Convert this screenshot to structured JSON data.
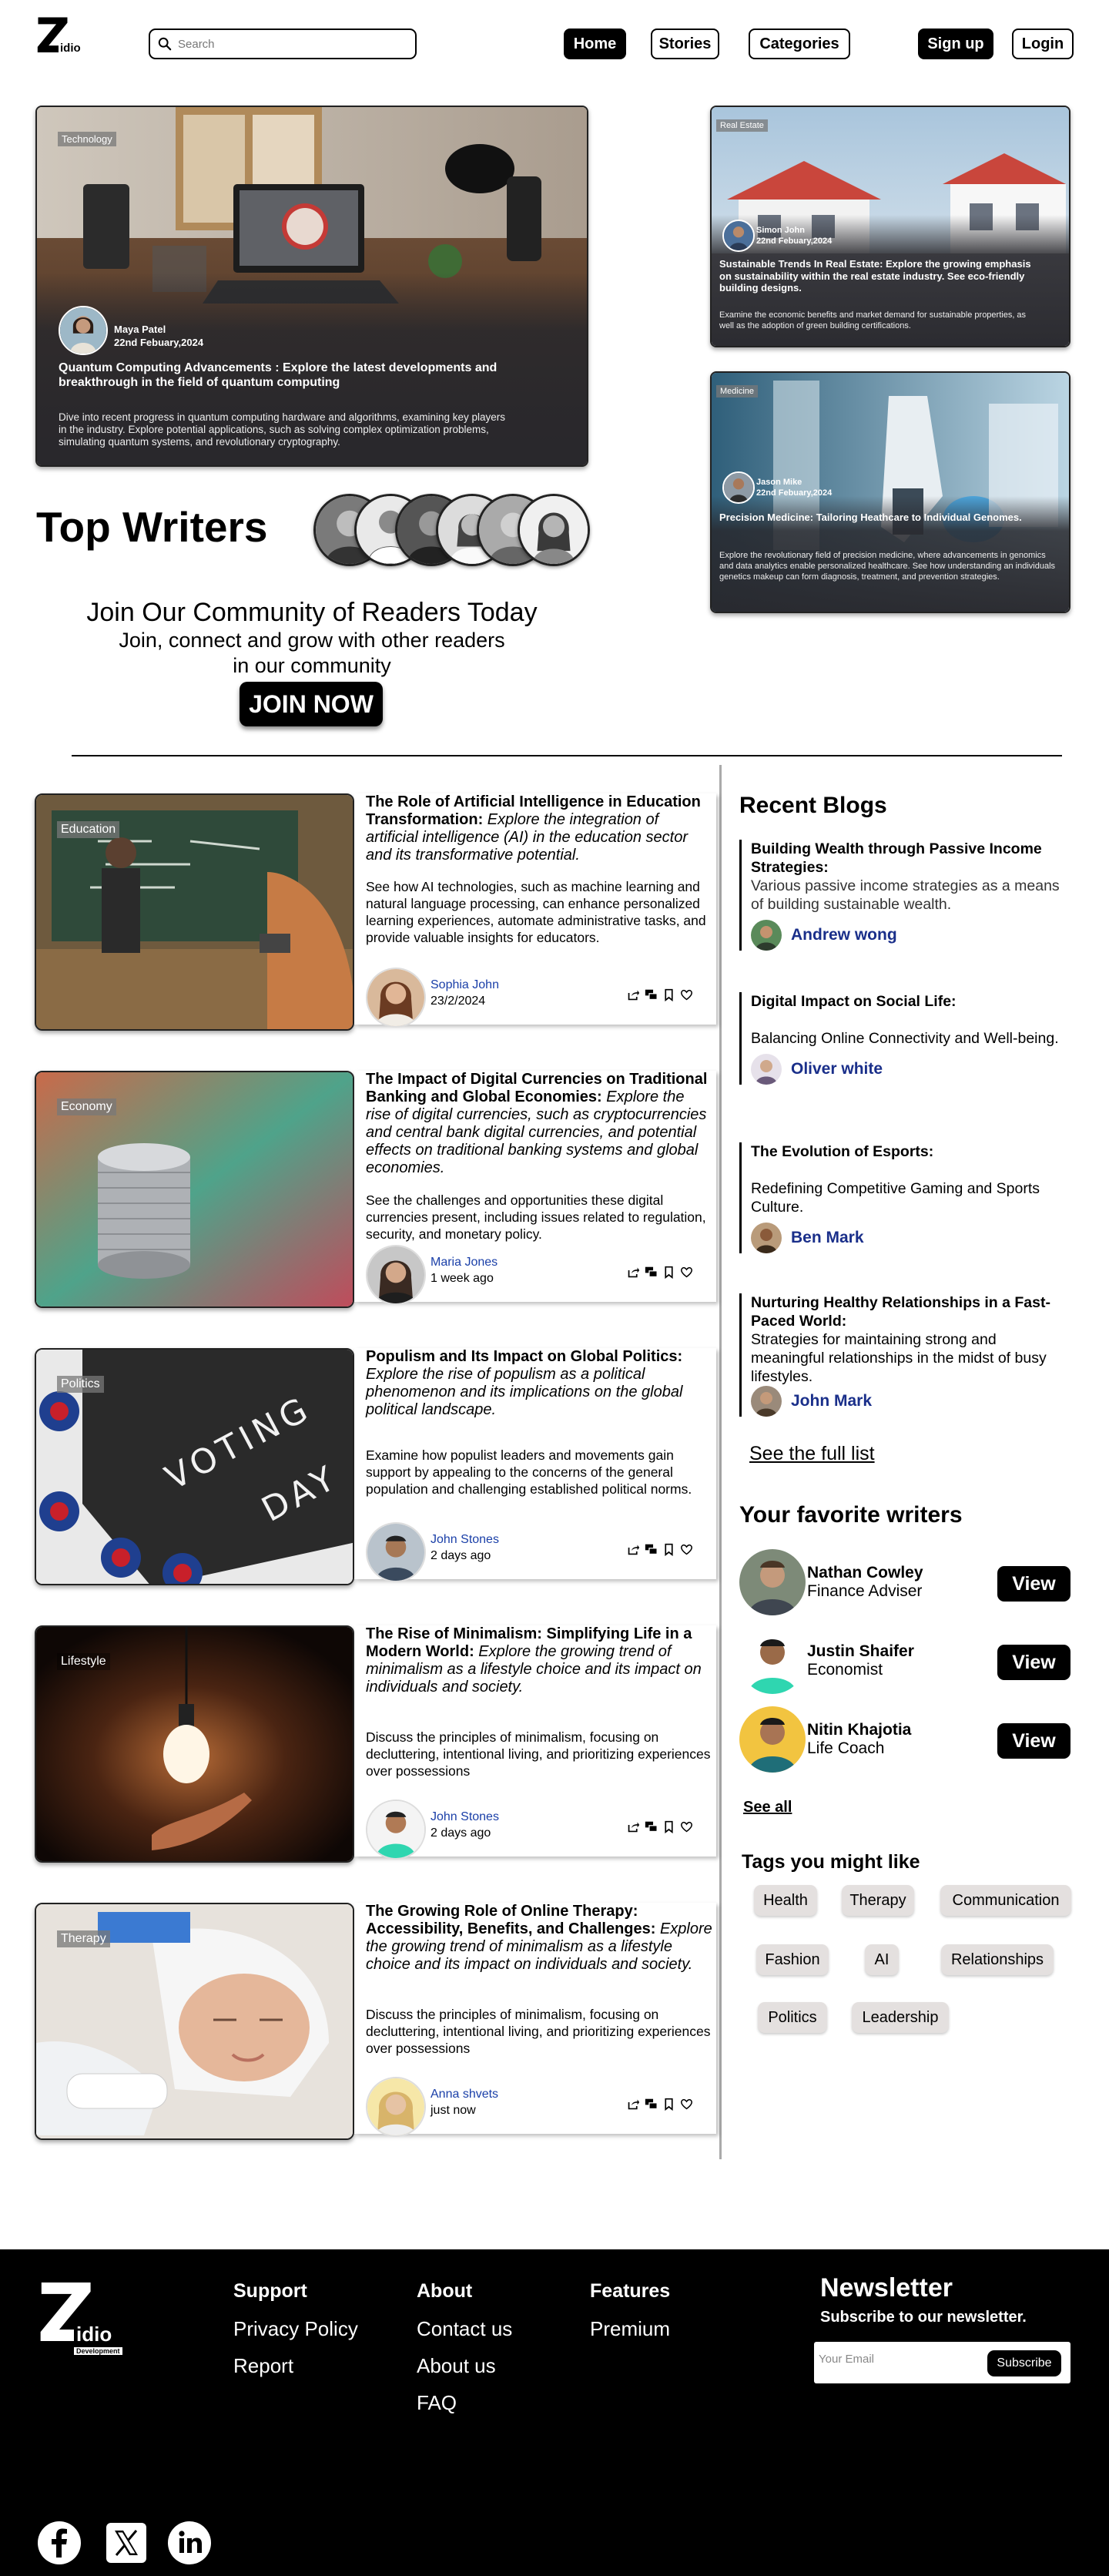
{
  "brand": {
    "logo_letter": "Z",
    "logo_text": "idio",
    "logo_sub": "Development"
  },
  "nav": {
    "search_placeholder": "Search",
    "home": "Home",
    "stories": "Stories",
    "categories": "Categories",
    "signup": "Sign up",
    "login": "Login"
  },
  "hero": {
    "main": {
      "tag": "Technology",
      "author": "Maya Patel",
      "date": "22nd Febuary,2024",
      "title": "Quantum Computing Advancements : Explore the latest developments and breakthrough in the field of quantum computing",
      "desc": "Dive into recent progress in quantum computing hardware and algorithms, examining key players in the industry. Explore potential applications, such as solving complex optimization problems, simulating quantum systems, and revolutionary cryptography."
    },
    "side1": {
      "tag": "Real Estate",
      "author": "Simon John",
      "date": "22nd Febuary,2024",
      "title": "Sustainable Trends In Real Estate: Explore the growing emphasis on sustainability within the real estate industry. See eco-friendly building designs.",
      "desc": "Examine the economic benefits and market demand for sustainable properties, as well as the adoption of green building certifications."
    },
    "side2": {
      "tag": "Medicine",
      "author": "Jason Mike",
      "date": "22nd Febuary,2024",
      "title": "Precision Medicine: Tailoring Heathcare to Individual Genomes.",
      "desc": "Explore the revolutionary field of precision medicine, where advancements in genomics and data analytics enable personalized healthcare. See how understanding an individuals genetics makeup can form diagnosis, treatment, and prevention strategies."
    }
  },
  "top_writers": {
    "title": "Top Writers"
  },
  "community": {
    "title": "Join Our Community of Readers Today",
    "line1": "Join, connect and grow with other readers",
    "line2": "in our community",
    "button": "JOIN NOW"
  },
  "articles": [
    {
      "tag": "Education",
      "title_bold": "The Role of Artificial Intelligence in Education Transformation:",
      "title_italic": " Explore the integration of  artificial intelligence (AI) in the education sector and its transformative potential.",
      "desc": "See how AI technologies, such as machine learning and natural language processing, can enhance personalized learning experiences, automate administrative tasks, and provide valuable insights for educators.",
      "author": "Sophia John",
      "date": "23/2/2024"
    },
    {
      "tag": "Economy",
      "title_bold": "The Impact of Digital Currencies on Traditional Banking and Global Economies:",
      "title_italic": " Explore the rise of digital currencies, such as cryptocurrencies and central bank digital currencies, and potential effects on traditional banking systems and global economies.",
      "desc": "See the challenges and opportunities these digital currencies present, including issues related to regulation, security, and monetary policy.",
      "author": "Maria Jones",
      "date": "1 week ago"
    },
    {
      "tag": "Politics",
      "title_bold": "Populism and Its Impact on Global Politics:",
      "title_italic": " Explore the rise of populism as a political phenomenon and its implications on the global political landscape.",
      "desc": "Examine how populist leaders and movements gain support by appealing to the concerns of the general population and challenging established political norms.",
      "author": "John Stones",
      "date": "2 days ago"
    },
    {
      "tag": "Lifestyle",
      "title_bold": "The Rise of Minimalism: Simplifying Life in a Modern World:",
      "title_italic": " Explore the growing trend of minimalism as a lifestyle choice and its impact on individuals and society.",
      "desc": "Discuss the principles of minimalism, focusing on decluttering, intentional living, and prioritizing experiences over possessions",
      "author": "John Stones",
      "date": "2 days ago"
    },
    {
      "tag": "Therapy",
      "title_bold": "The Growing Role of Online Therapy: Accessibility, Benefits, and Challenges:",
      "title_italic": " Explore the growing trend of minimalism as a lifestyle choice and its impact on individuals and society.",
      "desc": "Discuss the principles of minimalism, focusing on decluttering, intentional living, and prioritizing experiences over possessions",
      "author": "Anna shvets",
      "date": "just now"
    }
  ],
  "recent": {
    "title": "Recent Blogs",
    "items": [
      {
        "title": "Building Wealth through Passive Income Strategies:",
        "sub": "Various passive income strategies as a means of building sustainable wealth.",
        "author": "Andrew wong"
      },
      {
        "title": "Digital Impact on Social Life:",
        "sub": "Balancing Online Connectivity and Well-being.",
        "author": "Oliver white"
      },
      {
        "title": "The Evolution of Esports:",
        "sub": "Redefining Competitive Gaming and Sports Culture.",
        "author": "Ben Mark"
      },
      {
        "title": "Nurturing Healthy Relationships in a Fast-Paced World:",
        "sub": "Strategies for maintaining strong and meaningful relationships in the midst of busy lifestyles.",
        "author": "John Mark"
      }
    ],
    "see_full": "See the full list"
  },
  "favorites": {
    "title": "Your favorite writers",
    "items": [
      {
        "name": "Nathan Cowley",
        "role": "Finance Adviser",
        "button": "View"
      },
      {
        "name": "Justin Shaifer",
        "role": "Economist",
        "button": "View"
      },
      {
        "name": "Nitin Khajotia",
        "role": "Life Coach",
        "button": "View"
      }
    ],
    "see_all": "See all"
  },
  "tags": {
    "title": "Tags you might like",
    "items": [
      "Health",
      "Therapy",
      "Communication",
      "Fashion",
      "AI",
      "Relationships",
      "Politics",
      "Leadership"
    ]
  },
  "footer": {
    "support": {
      "heading": "Support",
      "links": [
        "Privacy Policy",
        "Report"
      ]
    },
    "about": {
      "heading": "About",
      "links": [
        "Contact us",
        "About us",
        "FAQ"
      ]
    },
    "features": {
      "heading": "Features",
      "links": [
        "Premium"
      ]
    },
    "newsletter": {
      "title": "Newsletter",
      "subtitle": "Subscribe to our newsletter.",
      "placeholder": "Your Email",
      "button": "Subscribe"
    }
  },
  "icons": [
    "search-icon",
    "share-icon",
    "comment-icon",
    "bookmark-icon",
    "heart-icon",
    "facebook-icon",
    "x-icon",
    "linkedin-icon"
  ]
}
